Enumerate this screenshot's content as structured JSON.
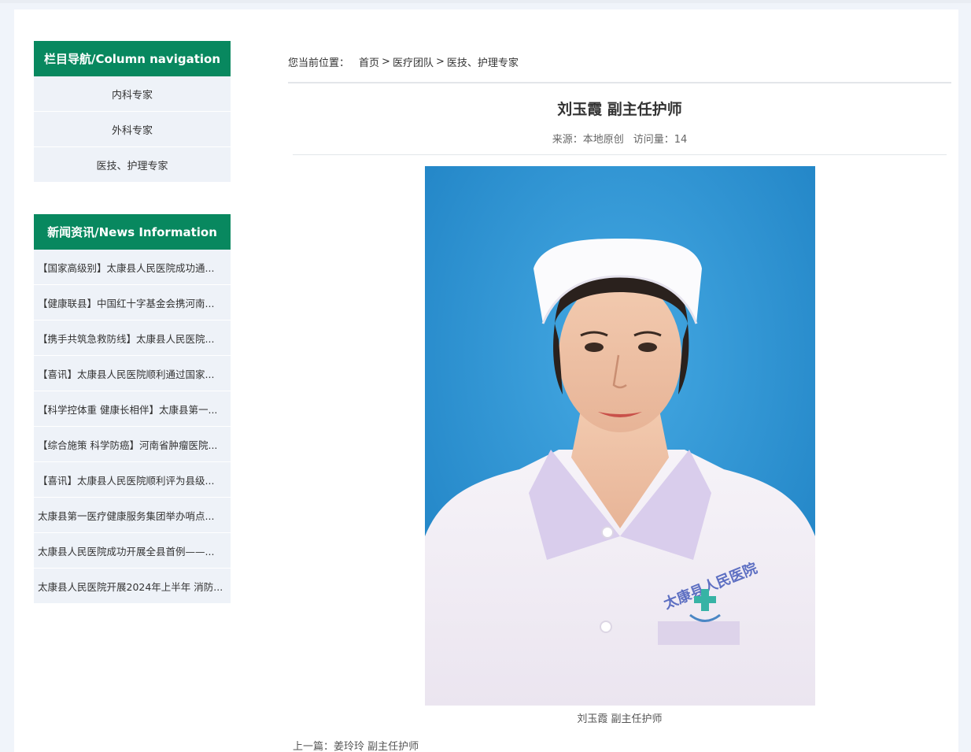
{
  "sidebar": {
    "column_nav": {
      "title": "栏目导航/Column navigation",
      "items": [
        "内科专家",
        "外科专家",
        "医技、护理专家"
      ]
    },
    "news": {
      "title": "新闻资讯/News Information",
      "items": [
        "【国家高级别】太康县人民医院成功通...",
        "【健康联县】中国红十字基金会携河南...",
        "【携手共筑急救防线】太康县人民医院...",
        "【喜讯】太康县人民医院顺利通过国家...",
        "【科学控体重 健康长相伴】太康县第一...",
        "【综合施策 科学防癌】河南省肿瘤医院...",
        "【喜讯】太康县人民医院顺利评为县级...",
        "太康县第一医疗健康服务集团举办哨点...",
        "太康县人民医院成功开展全县首例——...",
        "太康县人民医院开展2024年上半年 消防..."
      ]
    }
  },
  "breadcrumb": {
    "label": "您当前位置：",
    "items": [
      "首页",
      "医疗团队",
      "医技、护理专家"
    ],
    "separator": ">"
  },
  "article": {
    "title": "刘玉霞 副主任护师",
    "source_label": "来源：",
    "source_value": "本地原创",
    "views_label": "访问量：",
    "views_value": "14",
    "photo_caption": "刘玉霞 副主任护师",
    "logo_text": "太康县人民医院",
    "next_line": "上一篇：姜玲玲 副主任护师"
  },
  "colors": {
    "brand_green": "#08885f",
    "photo_bg_blue": "#2e8fce",
    "sidebar_item_bg": "#eef2f8"
  }
}
